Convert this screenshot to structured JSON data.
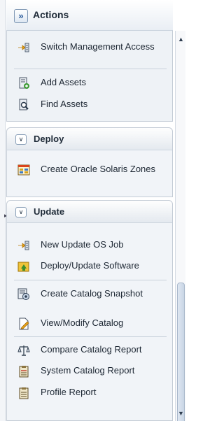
{
  "actions": {
    "title": "Actions",
    "expand_glyph": "»"
  },
  "top_items": [
    {
      "label": "Switch Management Access",
      "icon": "switch-access-icon"
    },
    {
      "label": "Add Assets",
      "icon": "add-assets-icon"
    },
    {
      "label": "Find Assets",
      "icon": "find-assets-icon"
    }
  ],
  "deploy": {
    "title": "Deploy",
    "items": [
      {
        "label": "Create Oracle Solaris Zones",
        "icon": "zones-icon"
      }
    ]
  },
  "update": {
    "title": "Update",
    "items": [
      {
        "label": "New Update OS Job",
        "icon": "update-job-icon"
      },
      {
        "label": "Deploy/Update Software",
        "icon": "deploy-software-icon"
      },
      {
        "label": "Create Catalog Snapshot",
        "icon": "catalog-snapshot-icon"
      },
      {
        "label": "View/Modify Catalog",
        "icon": "modify-catalog-icon"
      },
      {
        "label": "Compare Catalog Report",
        "icon": "compare-report-icon"
      },
      {
        "label": "System Catalog Report",
        "icon": "system-report-icon"
      },
      {
        "label": "Profile Report",
        "icon": "profile-report-icon"
      }
    ]
  },
  "colors": {
    "accent": "#2b5c9b",
    "panel": "#f1f4f8",
    "border": "#c4ccd6"
  }
}
